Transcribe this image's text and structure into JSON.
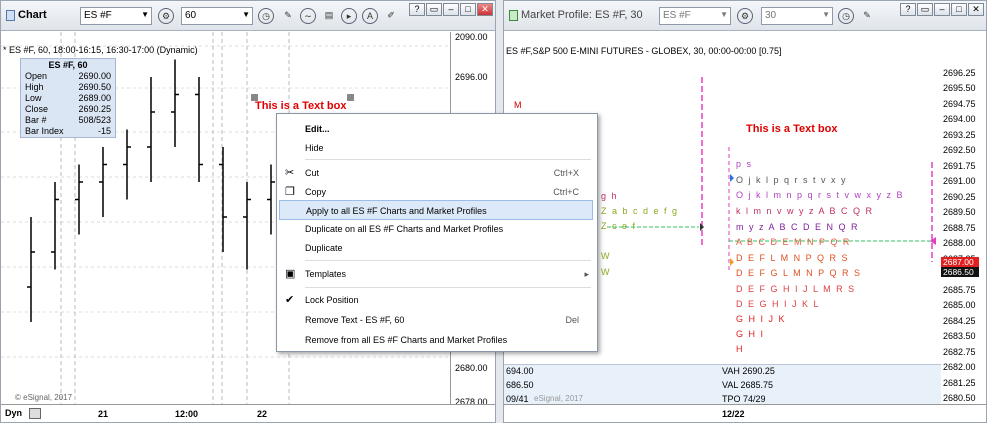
{
  "left": {
    "toolbar": {
      "title": "Chart",
      "symbol": "ES #F",
      "interval": "60"
    },
    "header": "* ES #F, 60, 18:00-16:15, 16:30-17:00 (Dynamic)",
    "info": {
      "title": "ES #F, 60",
      "rows": [
        {
          "k": "Open",
          "v": "2690.00"
        },
        {
          "k": "High",
          "v": "2690.50"
        },
        {
          "k": "Low",
          "v": "2689.00"
        },
        {
          "k": "Close",
          "v": "2690.25"
        },
        {
          "k": "Bar #",
          "v": "508/523"
        },
        {
          "k": "Bar Index",
          "v": "-15"
        }
      ]
    },
    "text_box": "This is a Text box",
    "y_labels": [
      "2696.00",
      "2680.00",
      "2678.00",
      "2090.00"
    ],
    "x_labels": [
      "21",
      "12:00",
      "22"
    ],
    "dyn": "Dyn",
    "copyright": "© eSignal, 2017",
    "chart_data": {
      "type": "ohlc",
      "ohlc": [
        [
          2684,
          2688,
          2682,
          2686
        ],
        [
          2686,
          2690,
          2685,
          2689
        ],
        [
          2689,
          2691,
          2687,
          2690
        ],
        [
          2690,
          2692,
          2688,
          2691
        ],
        [
          2691,
          2693,
          2689,
          2692
        ],
        [
          2692,
          2696,
          2690,
          2694
        ],
        [
          2694,
          2697,
          2692,
          2695
        ],
        [
          2695,
          2696,
          2690,
          2691
        ],
        [
          2691,
          2692,
          2686,
          2688
        ],
        [
          2688,
          2690,
          2685,
          2689
        ],
        [
          2689,
          2691,
          2687,
          2690
        ]
      ]
    }
  },
  "menu": {
    "items": [
      {
        "label": "Edit...",
        "shortcut": "",
        "icon": ""
      },
      {
        "label": "Hide",
        "shortcut": "",
        "icon": ""
      },
      {
        "label": "Cut",
        "shortcut": "Ctrl+X",
        "icon": "scissors-icon"
      },
      {
        "label": "Copy",
        "shortcut": "Ctrl+C",
        "icon": "copy-icon"
      },
      {
        "label": "Apply to all ES #F Charts and Market Profiles",
        "shortcut": "",
        "icon": ""
      },
      {
        "label": "Duplicate on all ES #F Charts and Market Profiles",
        "shortcut": "",
        "icon": ""
      },
      {
        "label": "Duplicate",
        "shortcut": "",
        "icon": ""
      },
      {
        "label": "Templates",
        "shortcut": "",
        "icon": "templates-icon"
      },
      {
        "label": "Lock Position",
        "shortcut": "",
        "icon": "check-icon"
      },
      {
        "label": "Remove Text - ES #F, 60",
        "shortcut": "Del",
        "icon": ""
      },
      {
        "label": "Remove from all ES #F Charts and Market Profiles",
        "shortcut": "",
        "icon": ""
      }
    ]
  },
  "right": {
    "toolbar": {
      "title": "Market Profile: ES #F, 30",
      "symbol": "ES #F",
      "interval": "30"
    },
    "header": "ES #F,S&P 500 E-MINI FUTURES - GLOBEX, 30, 00:00-00:00 [0.75]",
    "text_box": "This is a Text box",
    "y_labels": [
      "2696.25",
      "2695.50",
      "2694.75",
      "2694.00",
      "2693.25",
      "2692.50",
      "2691.75",
      "2691.00",
      "2690.25",
      "2689.50",
      "2688.75",
      "2688.00",
      "2687.25",
      "2686.50",
      "2685.75",
      "2685.00",
      "2684.25",
      "2683.50",
      "2682.75",
      "2682.00",
      "2681.25",
      "2680.50"
    ],
    "price_tags": [
      "2687.00",
      "2686.50"
    ],
    "profile_rows": [
      "p s",
      "O j k l p q r s t v x y",
      "O j k l m n p q r s t v w x y z B",
      "k l m n v w y z A B C Q R",
      "m y z A B C D E N Q R",
      "A B C D E M N P Q R",
      "D E F L M N P Q R S",
      "D E F G L M N P Q R S",
      "D E F G H I J L M R S",
      "D E G H I J K L",
      "G H I J K",
      "G H I",
      "H"
    ],
    "left_rows": [
      "g h",
      "Z a b c d e f g",
      "Z c e f",
      "W",
      "W"
    ],
    "marker_m": "M",
    "bottom": {
      "l1": "694.00",
      "l2": "686.50",
      "l3": "09/41",
      "r1": "VAH 2690.25",
      "r2": "VAL 2685.75",
      "r3": "TPO 74/29",
      "x_label": "12/22",
      "copyright": "eSignal, 2017"
    }
  }
}
